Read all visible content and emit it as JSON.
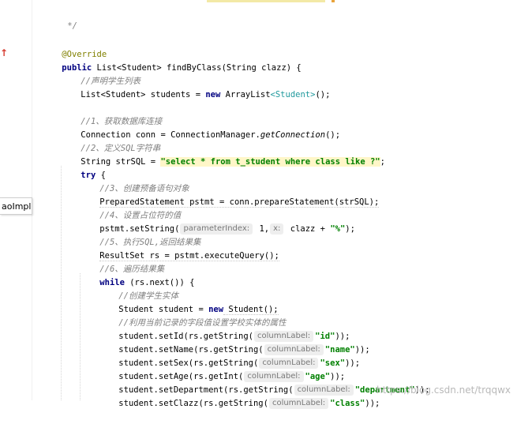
{
  "editor": {
    "override_icon": "implementation-override-icon",
    "tab_label": "aoImpl",
    "watermark": "https://blog.csdn.net/trqqwx",
    "lines": {
      "l1": "*/",
      "l2": "@Override",
      "l3_a": "public",
      "l3_b": " List<Student> findByClass(String clazz) {",
      "l4": "//声明学生列表",
      "l5_a": "List<Student> students = ",
      "l5_b": "new",
      "l5_c": " ArrayList",
      "l5_d": "<Student>",
      "l5_e": "();",
      "l6": "//1、获取数据库连接",
      "l7_a": "Connection conn = ConnectionManager.",
      "l7_b": "getConnection",
      "l7_c": "();",
      "l8": "//2、定义SQL字符串",
      "l9_a": "String strSQL = ",
      "l9_b": "\"select * from t_student where class like ?\"",
      "l9_c": ";",
      "l10_a": "try",
      "l10_b": " {",
      "l11": "//3、创建预备语句对象",
      "l12": "PreparedStatement pstmt = conn.prepareStatement(strSQL);",
      "l13": "//4、设置占位符的值",
      "l14_a": "pstmt.setString(",
      "l14_h1": "parameterIndex:",
      "l14_b": " 1,",
      "l14_h2": "x:",
      "l14_c": " clazz + ",
      "l14_d": "\"%\"",
      "l14_e": ");",
      "l15": "//5、执行SQL,返回结果集",
      "l16": "ResultSet rs = pstmt.executeQuery();",
      "l17": "//6、遍历结果集",
      "l18_a": "while",
      "l18_b": " (rs.next()) {",
      "l19": "//创建学生实体",
      "l20_a": "Student student = ",
      "l20_b": "new",
      "l20_c": " Student();",
      "l21": "//利用当前记录的字段值设置学校实体的属性",
      "l22_a": "student.setId(rs.getString(",
      "l22_h": "columnLabel:",
      "l22_s": "\"id\"",
      "l22_e": "));",
      "l23_a": "student.setName(rs.getString(",
      "l23_h": "columnLabel:",
      "l23_s": "\"name\"",
      "l23_e": "));",
      "l24_a": "student.setSex(rs.getString(",
      "l24_h": "columnLabel:",
      "l24_s": "\"sex\"",
      "l24_e": "));",
      "l25_a": "student.setAge(rs.getInt(",
      "l25_h": "columnLabel:",
      "l25_s": "\"age\"",
      "l25_e": "));",
      "l26_a": "student.setDepartment(rs.getString(",
      "l26_h": "columnLabel:",
      "l26_s": "\"department\"",
      "l26_e": "));",
      "l27_a": "student.setClazz(rs.getString(",
      "l27_h": "columnLabel:",
      "l27_s": "\"class\"",
      "l27_e": "));"
    }
  },
  "colors": {
    "keyword": "#000080",
    "annotation": "#808000",
    "comment": "#808080",
    "string": "#008000",
    "generic": "#20999d",
    "override_marker": "#d63b2f"
  }
}
